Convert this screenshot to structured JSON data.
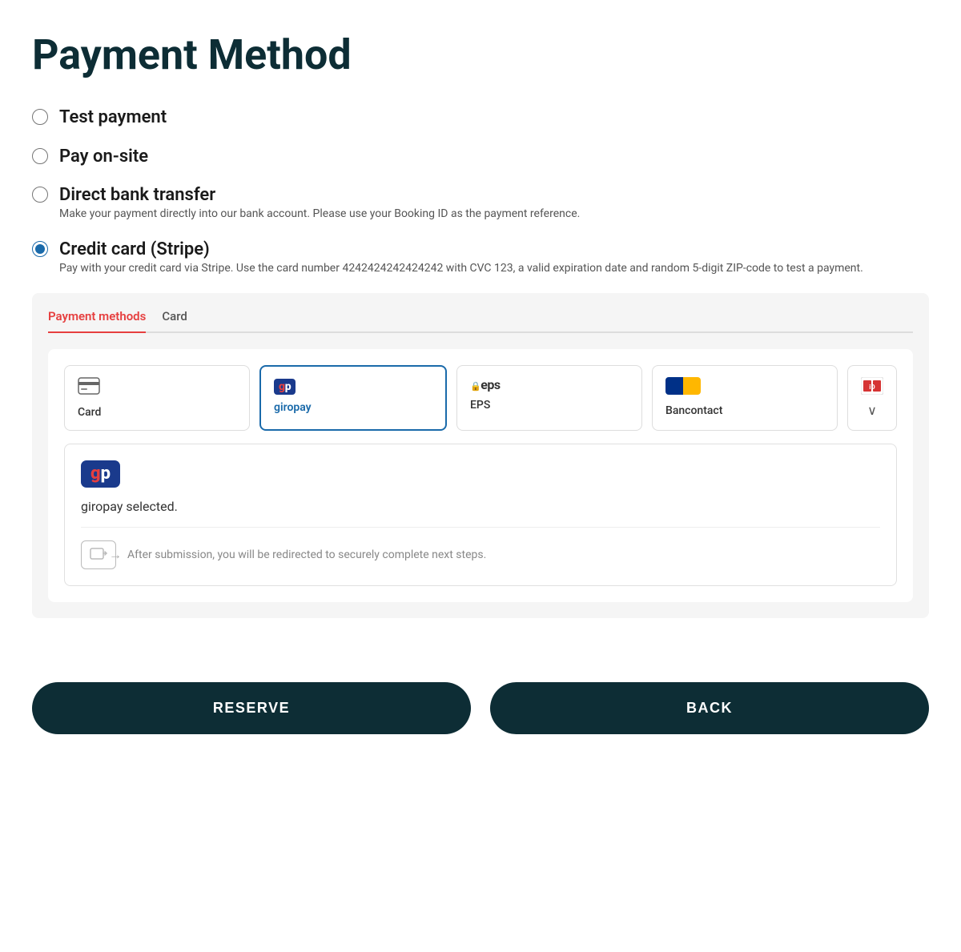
{
  "page": {
    "title": "Payment Method"
  },
  "payment_options": [
    {
      "id": "test",
      "label": "Test payment",
      "selected": false,
      "note": null
    },
    {
      "id": "onsite",
      "label": "Pay on-site",
      "selected": false,
      "note": null
    },
    {
      "id": "bank",
      "label": "Direct bank transfer",
      "selected": false,
      "note": "Make your payment directly into our bank account. Please use your Booking ID as the payment reference."
    },
    {
      "id": "stripe",
      "label": "Credit card (Stripe)",
      "selected": true,
      "note": "Pay with your credit card via Stripe. Use the card number 4242424242424242 with CVC 123, a valid expiration date and random 5-digit ZIP-code to test a payment."
    }
  ],
  "stripe_widget": {
    "tabs": [
      {
        "id": "payment_methods",
        "label": "Payment methods",
        "active": true
      },
      {
        "id": "card",
        "label": "Card",
        "active": false
      }
    ],
    "methods": [
      {
        "id": "card",
        "label": "Card",
        "icon": "card",
        "selected": false
      },
      {
        "id": "giropay",
        "label": "giropay",
        "icon": "giropay",
        "selected": true
      },
      {
        "id": "eps",
        "label": "EPS",
        "icon": "eps",
        "selected": false
      },
      {
        "id": "bancontact",
        "label": "Bancontact",
        "icon": "bancontact",
        "selected": false
      }
    ],
    "more_button_label": "⌄",
    "selected_method": {
      "name": "giropay",
      "text": "giropay selected.",
      "redirect_text": "After submission, you will be redirected to securely complete next steps."
    }
  },
  "buttons": {
    "reserve": "RESERVE",
    "back": "BACK"
  }
}
